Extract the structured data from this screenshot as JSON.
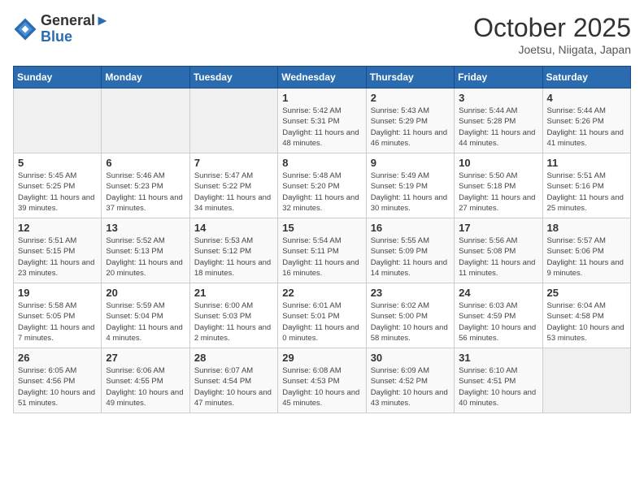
{
  "logo": {
    "line1": "General",
    "line2": "Blue"
  },
  "title": "October 2025",
  "location": "Joetsu, Niigata, Japan",
  "days_of_week": [
    "Sunday",
    "Monday",
    "Tuesday",
    "Wednesday",
    "Thursday",
    "Friday",
    "Saturday"
  ],
  "weeks": [
    [
      {
        "day": "",
        "sunrise": "",
        "sunset": "",
        "daylight": ""
      },
      {
        "day": "",
        "sunrise": "",
        "sunset": "",
        "daylight": ""
      },
      {
        "day": "",
        "sunrise": "",
        "sunset": "",
        "daylight": ""
      },
      {
        "day": "1",
        "sunrise": "Sunrise: 5:42 AM",
        "sunset": "Sunset: 5:31 PM",
        "daylight": "Daylight: 11 hours and 48 minutes."
      },
      {
        "day": "2",
        "sunrise": "Sunrise: 5:43 AM",
        "sunset": "Sunset: 5:29 PM",
        "daylight": "Daylight: 11 hours and 46 minutes."
      },
      {
        "day": "3",
        "sunrise": "Sunrise: 5:44 AM",
        "sunset": "Sunset: 5:28 PM",
        "daylight": "Daylight: 11 hours and 44 minutes."
      },
      {
        "day": "4",
        "sunrise": "Sunrise: 5:44 AM",
        "sunset": "Sunset: 5:26 PM",
        "daylight": "Daylight: 11 hours and 41 minutes."
      }
    ],
    [
      {
        "day": "5",
        "sunrise": "Sunrise: 5:45 AM",
        "sunset": "Sunset: 5:25 PM",
        "daylight": "Daylight: 11 hours and 39 minutes."
      },
      {
        "day": "6",
        "sunrise": "Sunrise: 5:46 AM",
        "sunset": "Sunset: 5:23 PM",
        "daylight": "Daylight: 11 hours and 37 minutes."
      },
      {
        "day": "7",
        "sunrise": "Sunrise: 5:47 AM",
        "sunset": "Sunset: 5:22 PM",
        "daylight": "Daylight: 11 hours and 34 minutes."
      },
      {
        "day": "8",
        "sunrise": "Sunrise: 5:48 AM",
        "sunset": "Sunset: 5:20 PM",
        "daylight": "Daylight: 11 hours and 32 minutes."
      },
      {
        "day": "9",
        "sunrise": "Sunrise: 5:49 AM",
        "sunset": "Sunset: 5:19 PM",
        "daylight": "Daylight: 11 hours and 30 minutes."
      },
      {
        "day": "10",
        "sunrise": "Sunrise: 5:50 AM",
        "sunset": "Sunset: 5:18 PM",
        "daylight": "Daylight: 11 hours and 27 minutes."
      },
      {
        "day": "11",
        "sunrise": "Sunrise: 5:51 AM",
        "sunset": "Sunset: 5:16 PM",
        "daylight": "Daylight: 11 hours and 25 minutes."
      }
    ],
    [
      {
        "day": "12",
        "sunrise": "Sunrise: 5:51 AM",
        "sunset": "Sunset: 5:15 PM",
        "daylight": "Daylight: 11 hours and 23 minutes."
      },
      {
        "day": "13",
        "sunrise": "Sunrise: 5:52 AM",
        "sunset": "Sunset: 5:13 PM",
        "daylight": "Daylight: 11 hours and 20 minutes."
      },
      {
        "day": "14",
        "sunrise": "Sunrise: 5:53 AM",
        "sunset": "Sunset: 5:12 PM",
        "daylight": "Daylight: 11 hours and 18 minutes."
      },
      {
        "day": "15",
        "sunrise": "Sunrise: 5:54 AM",
        "sunset": "Sunset: 5:11 PM",
        "daylight": "Daylight: 11 hours and 16 minutes."
      },
      {
        "day": "16",
        "sunrise": "Sunrise: 5:55 AM",
        "sunset": "Sunset: 5:09 PM",
        "daylight": "Daylight: 11 hours and 14 minutes."
      },
      {
        "day": "17",
        "sunrise": "Sunrise: 5:56 AM",
        "sunset": "Sunset: 5:08 PM",
        "daylight": "Daylight: 11 hours and 11 minutes."
      },
      {
        "day": "18",
        "sunrise": "Sunrise: 5:57 AM",
        "sunset": "Sunset: 5:06 PM",
        "daylight": "Daylight: 11 hours and 9 minutes."
      }
    ],
    [
      {
        "day": "19",
        "sunrise": "Sunrise: 5:58 AM",
        "sunset": "Sunset: 5:05 PM",
        "daylight": "Daylight: 11 hours and 7 minutes."
      },
      {
        "day": "20",
        "sunrise": "Sunrise: 5:59 AM",
        "sunset": "Sunset: 5:04 PM",
        "daylight": "Daylight: 11 hours and 4 minutes."
      },
      {
        "day": "21",
        "sunrise": "Sunrise: 6:00 AM",
        "sunset": "Sunset: 5:03 PM",
        "daylight": "Daylight: 11 hours and 2 minutes."
      },
      {
        "day": "22",
        "sunrise": "Sunrise: 6:01 AM",
        "sunset": "Sunset: 5:01 PM",
        "daylight": "Daylight: 11 hours and 0 minutes."
      },
      {
        "day": "23",
        "sunrise": "Sunrise: 6:02 AM",
        "sunset": "Sunset: 5:00 PM",
        "daylight": "Daylight: 10 hours and 58 minutes."
      },
      {
        "day": "24",
        "sunrise": "Sunrise: 6:03 AM",
        "sunset": "Sunset: 4:59 PM",
        "daylight": "Daylight: 10 hours and 56 minutes."
      },
      {
        "day": "25",
        "sunrise": "Sunrise: 6:04 AM",
        "sunset": "Sunset: 4:58 PM",
        "daylight": "Daylight: 10 hours and 53 minutes."
      }
    ],
    [
      {
        "day": "26",
        "sunrise": "Sunrise: 6:05 AM",
        "sunset": "Sunset: 4:56 PM",
        "daylight": "Daylight: 10 hours and 51 minutes."
      },
      {
        "day": "27",
        "sunrise": "Sunrise: 6:06 AM",
        "sunset": "Sunset: 4:55 PM",
        "daylight": "Daylight: 10 hours and 49 minutes."
      },
      {
        "day": "28",
        "sunrise": "Sunrise: 6:07 AM",
        "sunset": "Sunset: 4:54 PM",
        "daylight": "Daylight: 10 hours and 47 minutes."
      },
      {
        "day": "29",
        "sunrise": "Sunrise: 6:08 AM",
        "sunset": "Sunset: 4:53 PM",
        "daylight": "Daylight: 10 hours and 45 minutes."
      },
      {
        "day": "30",
        "sunrise": "Sunrise: 6:09 AM",
        "sunset": "Sunset: 4:52 PM",
        "daylight": "Daylight: 10 hours and 43 minutes."
      },
      {
        "day": "31",
        "sunrise": "Sunrise: 6:10 AM",
        "sunset": "Sunset: 4:51 PM",
        "daylight": "Daylight: 10 hours and 40 minutes."
      },
      {
        "day": "",
        "sunrise": "",
        "sunset": "",
        "daylight": ""
      }
    ]
  ]
}
